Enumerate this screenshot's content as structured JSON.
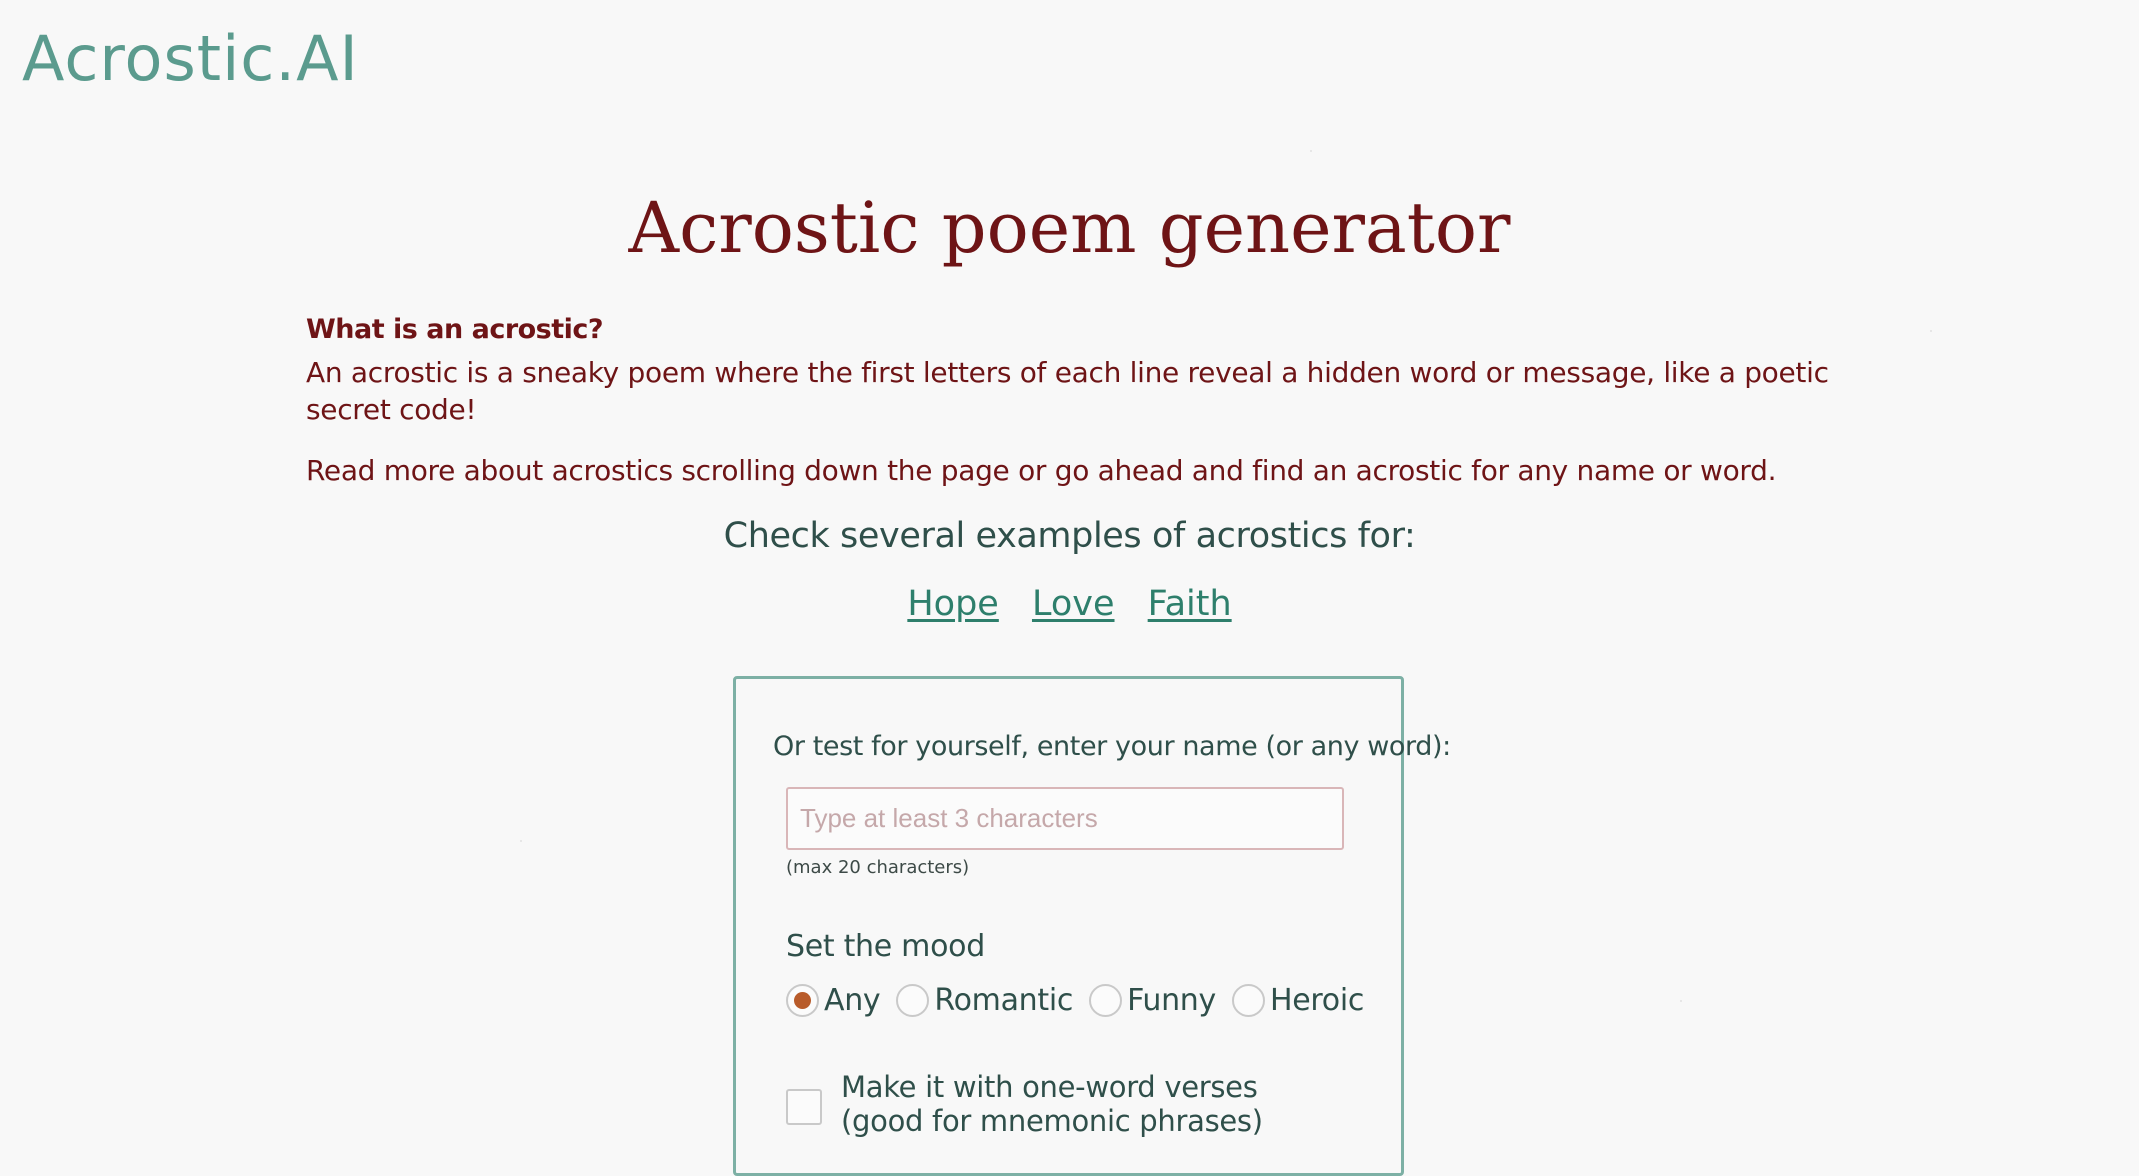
{
  "header": {
    "logo_text": "Acrostic.AI"
  },
  "main": {
    "title": "Acrostic poem generator",
    "intro": {
      "question": "What is an acrostic?",
      "paragraph1": "An acrostic is a sneaky poem where the first letters of each line reveal a hidden word or message, like a poetic secret code!",
      "paragraph2": "Read more about acrostics scrolling down the page or go ahead and find an acrostic for any name or word."
    },
    "examples": {
      "heading": "Check several examples of acrostics for:",
      "links": [
        "Hope",
        "Love",
        "Faith"
      ]
    },
    "form": {
      "label": "Or test for yourself, enter your name (or any word):",
      "input_placeholder": "Type at least 3 characters",
      "input_value": "",
      "max_note": "(max 20 characters)",
      "mood_label": "Set the mood",
      "moods": [
        "Any",
        "Romantic",
        "Funny",
        "Heroic"
      ],
      "selected_mood": "Any",
      "one_word_label_line1": "Make it with one-word verses",
      "one_word_label_line2": "(good for mnemonic phrases)",
      "one_word_checked": false
    }
  },
  "colors": {
    "title": "#6e1416",
    "accent": "#5b9b8e",
    "link": "#2e7f6c",
    "radio_selected": "#b85b2a"
  }
}
